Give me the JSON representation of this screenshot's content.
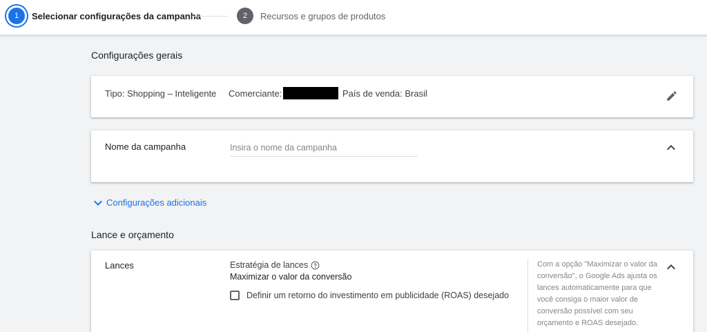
{
  "stepper": {
    "step1": {
      "number": "1",
      "label": "Selecionar configurações da campanha"
    },
    "step2": {
      "number": "2",
      "label": "Recursos e grupos de produtos"
    }
  },
  "general": {
    "title": "Configurações gerais",
    "type_text": "Tipo: Shopping – Inteligente",
    "merchant_label": "Comerciante:",
    "country_text": "País de venda: Brasil",
    "edit_icon": "pencil-icon"
  },
  "campaign_name": {
    "label": "Nome da campanha",
    "placeholder": "Insira o nome da campanha",
    "value": ""
  },
  "additional_settings": {
    "label": "Configurações adicionais"
  },
  "bidding": {
    "title": "Lance e orçamento",
    "label": "Lances",
    "strategy_label": "Estratégia de lances",
    "strategy_value": "Maximizar o valor da conversão",
    "roas_checkbox_label": "Definir um retorno do investimento em publicidade (ROAS) desejado",
    "help_text": "Com a opção \"Maximizar o valor da conversão\", o Google Ads ajusta os lances automaticamente para que você consiga o maior valor de conversão possível com seu orçamento e ROAS desejado."
  },
  "colors": {
    "accent": "#1a73e8",
    "text_primary": "#202124",
    "text_secondary": "#5f6368",
    "background": "#f1f3f4"
  }
}
